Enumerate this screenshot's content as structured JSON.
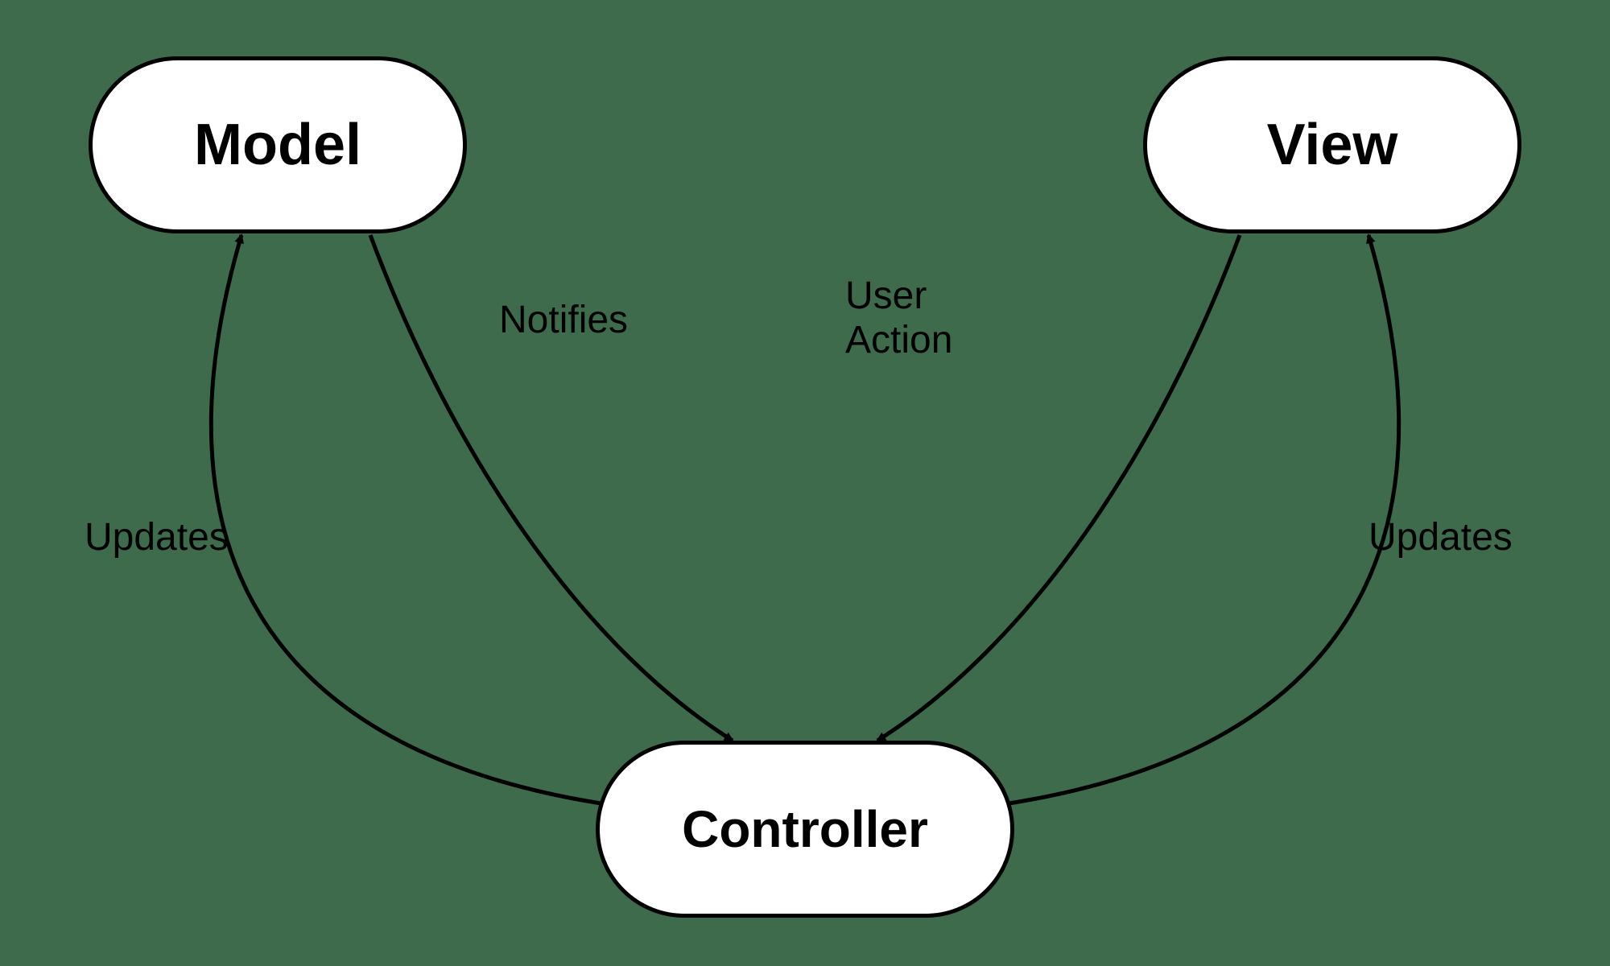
{
  "nodes": {
    "model": {
      "label": "Model"
    },
    "view": {
      "label": "View"
    },
    "controller": {
      "label": "Controller"
    }
  },
  "edges": {
    "model_to_controller": {
      "label": "Notifies"
    },
    "view_to_controller": {
      "label_line1": "User",
      "label_line2": "Action"
    },
    "controller_to_model": {
      "label": "Updates"
    },
    "controller_to_view": {
      "label": "Updates"
    }
  },
  "colors": {
    "background": "#3d6b4c",
    "node_fill": "#ffffff",
    "stroke": "#000000"
  }
}
